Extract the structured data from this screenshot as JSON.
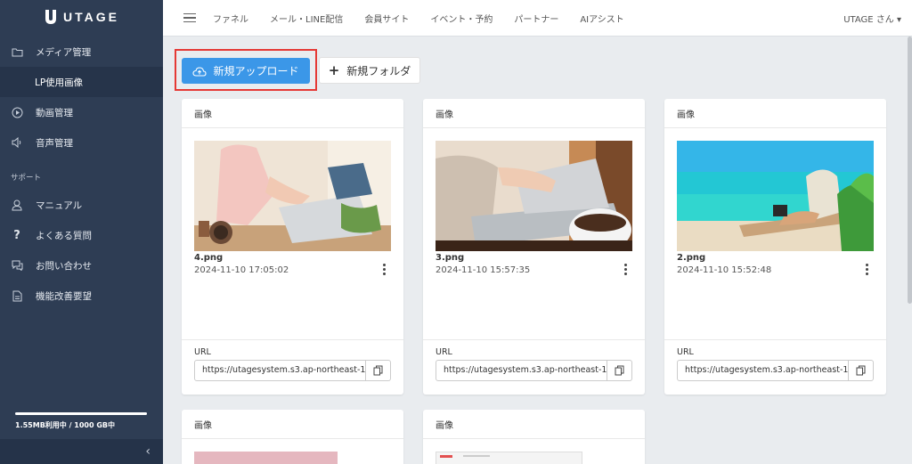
{
  "app": {
    "logo_text": "UTAGE"
  },
  "sidebar": {
    "items": [
      {
        "label": "メディア管理",
        "icon": "folder-icon"
      },
      {
        "label": "LP使用画像"
      },
      {
        "label": "動画管理",
        "icon": "play-circle-icon"
      },
      {
        "label": "音声管理",
        "icon": "speaker-icon"
      }
    ],
    "support_label": "サポート",
    "support_items": [
      {
        "label": "マニュアル",
        "icon": "user-icon"
      },
      {
        "label": "よくある質問",
        "icon": "question-icon"
      },
      {
        "label": "お問い合わせ",
        "icon": "chat-icon"
      },
      {
        "label": "機能改善要望",
        "icon": "document-icon"
      }
    ],
    "storage_text": "1.55MB利用中 / 1000 GB中",
    "storage_fraction": 0.00155,
    "collapse_glyph": "‹"
  },
  "topbar": {
    "nav": [
      "ファネル",
      "メール・LINE配信",
      "会員サイト",
      "イベント・予約",
      "パートナー",
      "AIアシスト"
    ],
    "user": "UTAGE さん ▾"
  },
  "toolbar": {
    "upload_label": "新規アップロード",
    "folder_label": "新規フォルダ"
  },
  "cards": [
    {
      "header": "画像",
      "filename": "4.png",
      "date": "2024-11-10 17:05:02",
      "url_label": "URL",
      "url": "https://utagesystem.s3.ap-northeast-1"
    },
    {
      "header": "画像",
      "filename": "3.png",
      "date": "2024-11-10 15:57:35",
      "url_label": "URL",
      "url": "https://utagesystem.s3.ap-northeast-1"
    },
    {
      "header": "画像",
      "filename": "2.png",
      "date": "2024-11-10 15:52:48",
      "url_label": "URL",
      "url": "https://utagesystem.s3.ap-northeast-1"
    },
    {
      "header": "画像"
    },
    {
      "header": "画像"
    }
  ],
  "colors": {
    "sidebar": "#2e3d54",
    "accent": "#3b97e8",
    "highlight": "#e53935"
  }
}
